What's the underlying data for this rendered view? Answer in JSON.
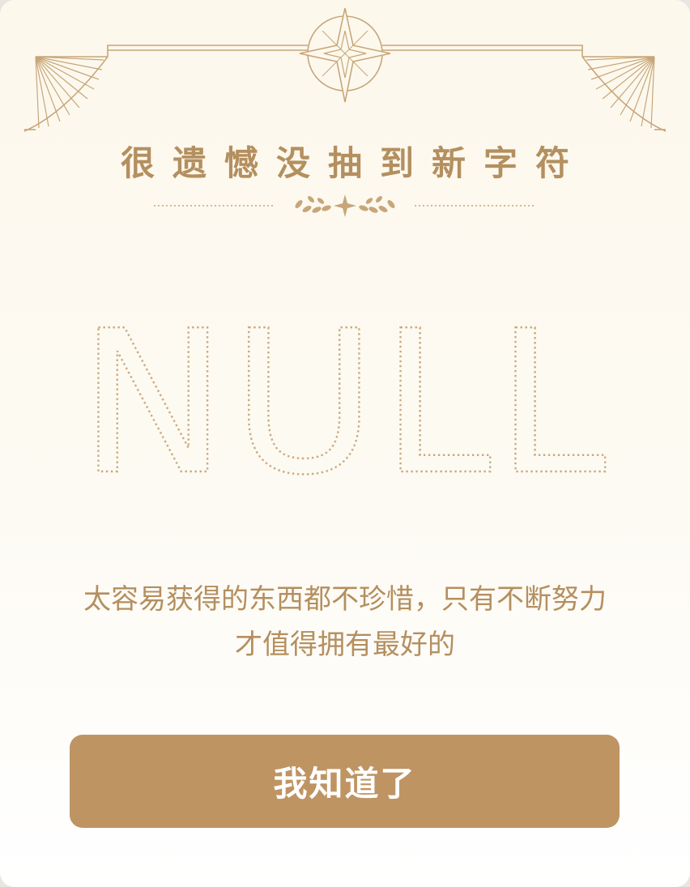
{
  "dialog": {
    "title": "很遗憾没抽到新字符",
    "result_word": "NULL",
    "message": "太容易获得的东西都不珍惜，只有不断努力才值得拥有最好的",
    "confirm_label": "我知道了"
  },
  "colors": {
    "accent": "#b48f5f",
    "button": "#bf9463",
    "background_top": "#fdf8ec",
    "background_bottom": "#ffffff"
  },
  "icons": {
    "top_ornament": "compass-star-icon",
    "divider_ornament": "laurel-sparkle-icon"
  }
}
